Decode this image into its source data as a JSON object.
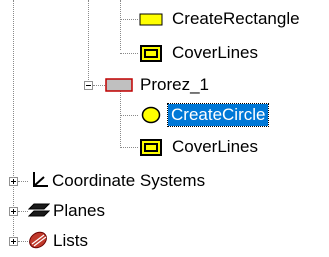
{
  "tree": {
    "items": [
      {
        "label": "CreateRectangle",
        "icon": "rectangle-icon"
      },
      {
        "label": "CoverLines",
        "icon": "cover-lines-icon"
      },
      {
        "label": "Prorez_1",
        "icon": "body-icon"
      },
      {
        "label": "CreateCircle",
        "icon": "circle-icon",
        "selected": true
      },
      {
        "label": "CoverLines",
        "icon": "cover-lines-icon"
      },
      {
        "label": "Coordinate Systems",
        "icon": "coordinate-systems-icon"
      },
      {
        "label": "Planes",
        "icon": "planes-icon"
      },
      {
        "label": "Lists",
        "icon": "lists-icon"
      }
    ]
  },
  "colors": {
    "selection": "#0078d7",
    "rectangle_fill": "#ffff00",
    "body_fill": "#c0c0c0",
    "body_border": "#c00000",
    "planes_fill": "#1a1a1a",
    "lists_fill": "#c0392b"
  }
}
